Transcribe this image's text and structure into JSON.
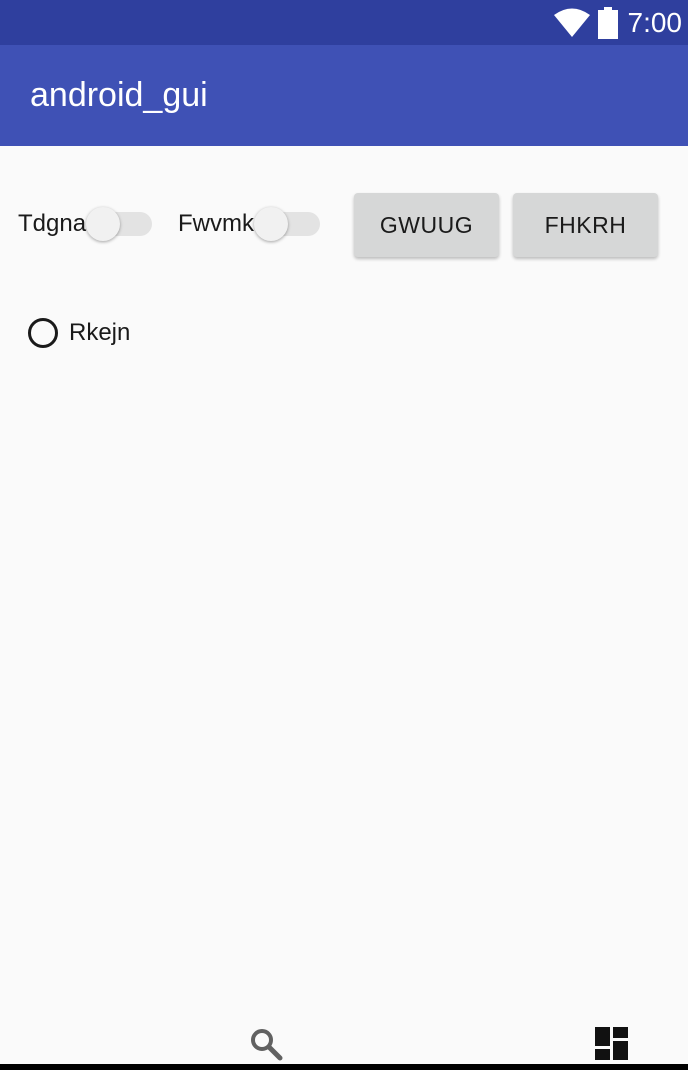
{
  "status_bar": {
    "time": "7:00",
    "icons": [
      "wifi-icon",
      "battery-icon"
    ],
    "background": "#2f3f9e"
  },
  "app_bar": {
    "title": "android_gui",
    "background": "#3f51b5"
  },
  "switches": [
    {
      "label": "Tdgna",
      "checked": false
    },
    {
      "label": "Fwvmk",
      "checked": false
    }
  ],
  "buttons": [
    {
      "label": "GWUUG"
    },
    {
      "label": "FHKRH"
    }
  ],
  "radio": {
    "label": "Rkejn",
    "checked": false
  },
  "bottom_bar": {
    "icons": [
      "search-icon",
      "dashboard-icon"
    ]
  }
}
